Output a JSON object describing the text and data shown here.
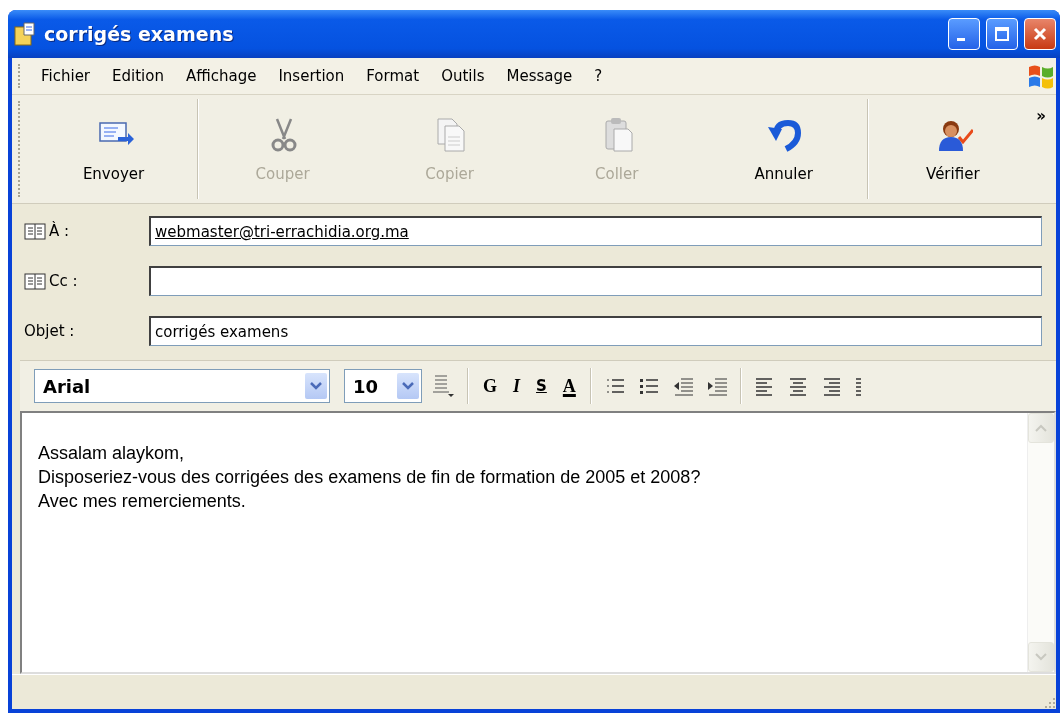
{
  "window": {
    "title": "corrigés examens"
  },
  "menu": [
    {
      "label": "Fichier"
    },
    {
      "label": "Edition"
    },
    {
      "label": "Affichage"
    },
    {
      "label": "Insertion"
    },
    {
      "label": "Format"
    },
    {
      "label": "Outils"
    },
    {
      "label": "Message"
    },
    {
      "label": "?"
    }
  ],
  "toolbar": {
    "buttons": [
      {
        "label": "Envoyer",
        "disabled": false
      },
      {
        "label": "Couper",
        "disabled": true
      },
      {
        "label": "Copier",
        "disabled": true
      },
      {
        "label": "Coller",
        "disabled": true
      },
      {
        "label": "Annuler",
        "disabled": false
      },
      {
        "label": "Vérifier",
        "disabled": false
      }
    ],
    "overflow": "»"
  },
  "fields": [
    {
      "label": "À :",
      "address_book": true,
      "value": "webmaster@tri-errachidia.org.ma",
      "resolved": true
    },
    {
      "label": "Cc :",
      "address_book": true
    },
    {
      "label": "Objet :",
      "address_book": false,
      "value": "corrigés examens",
      "resolved": false
    }
  ],
  "format_bar": {
    "font": "Arial",
    "size": "10",
    "style_buttons": [
      "G",
      "I",
      "S",
      "A"
    ]
  },
  "body": {
    "lines": [
      "Assalam alaykom,",
      "Disposeriez-vous des corrigées des examens de fin de formation de 2005 et 2008?",
      "Avec mes remerciements."
    ]
  }
}
